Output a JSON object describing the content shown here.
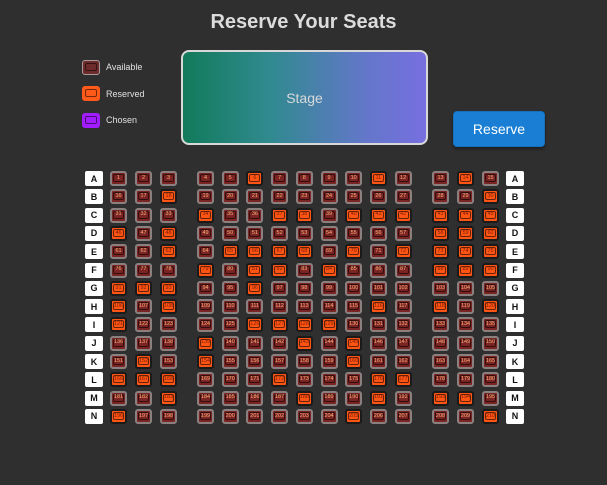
{
  "title": "Reserve Your Seats",
  "legend": {
    "available": "Available",
    "reserved": "Reserved",
    "chosen": "Chosen"
  },
  "stage_label": "Stage",
  "reserve_button": "Reserve",
  "colors": {
    "available": "#7a2424",
    "reserved": "#ff5514",
    "chosen": "#a21cff",
    "button": "#1a7fd4"
  },
  "rows": [
    "A",
    "B",
    "C",
    "D",
    "E",
    "F",
    "G",
    "H",
    "I",
    "J",
    "K",
    "L",
    "M",
    "N"
  ],
  "seats_per_row": 15,
  "reserved_seats": [
    6,
    11,
    14,
    18,
    30,
    34,
    37,
    38,
    40,
    41,
    42,
    43,
    44,
    45,
    46,
    48,
    58,
    59,
    60,
    63,
    65,
    66,
    67,
    68,
    70,
    72,
    73,
    74,
    75,
    79,
    81,
    82,
    84,
    88,
    89,
    90,
    91,
    92,
    93,
    96,
    106,
    108,
    116,
    118,
    120,
    121,
    126,
    127,
    128,
    129,
    139,
    143,
    145,
    152,
    154,
    160,
    166,
    167,
    168,
    172,
    176,
    177,
    183,
    188,
    191,
    193,
    194,
    196,
    205,
    210
  ]
}
